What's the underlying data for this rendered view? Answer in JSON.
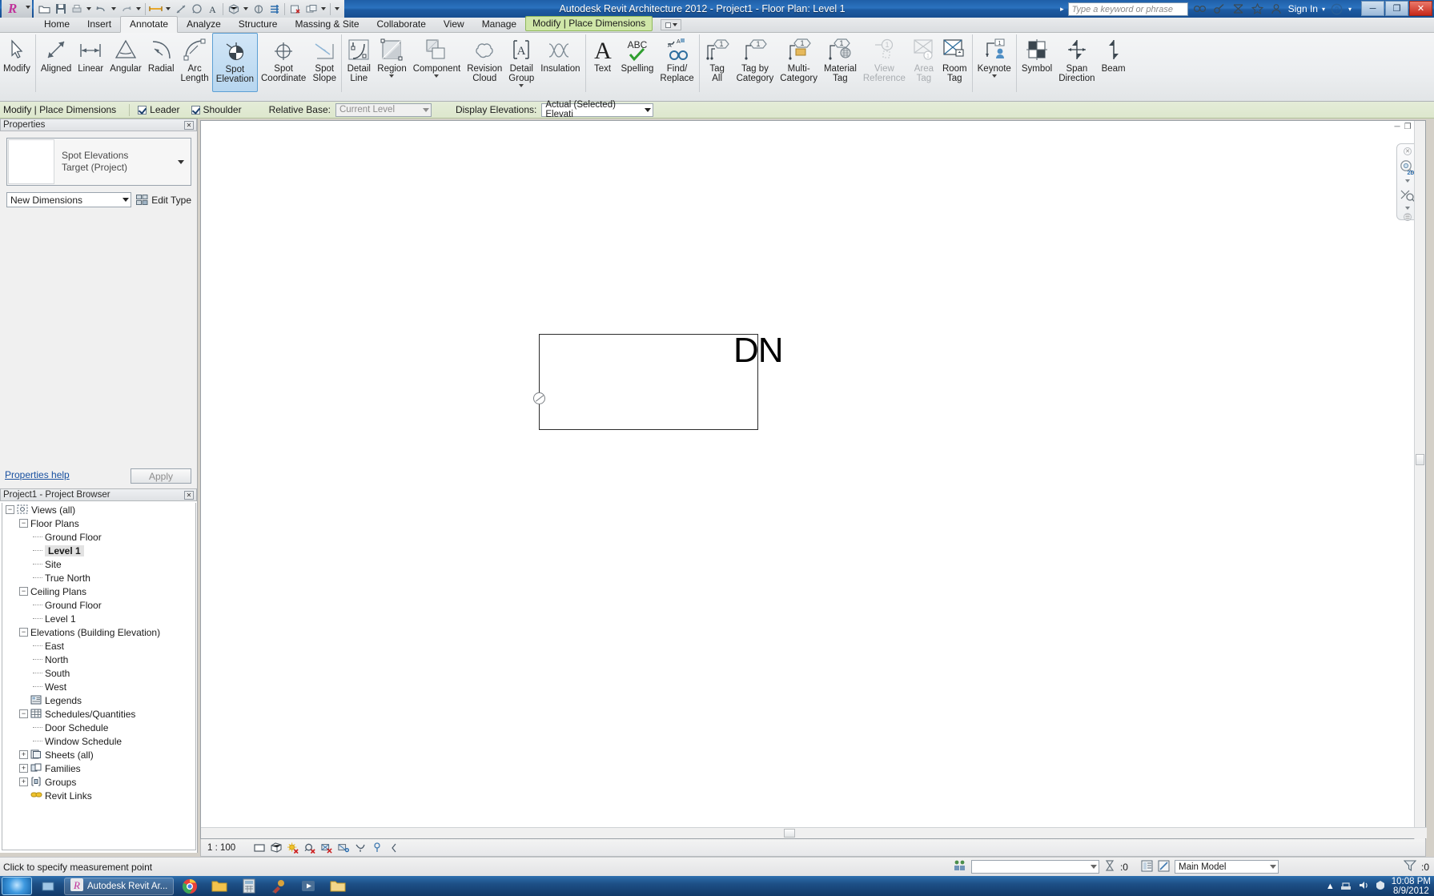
{
  "titlebar": {
    "app_title": "Autodesk Revit Architecture 2012 -    Project1 - Floor Plan: Level 1",
    "search_placeholder": "Type a keyword or phrase",
    "sign_in": "Sign In",
    "quick_access": [
      {
        "name": "open-icon",
        "label": "Open"
      },
      {
        "name": "save-icon",
        "label": "Save"
      },
      {
        "name": "print-icon",
        "label": "Print"
      },
      {
        "name": "undo-icon",
        "label": "Undo"
      },
      {
        "name": "redo-icon",
        "label": "Redo"
      },
      {
        "name": "measure-icon",
        "label": "Measure"
      },
      {
        "name": "aligned-dimension-icon",
        "label": "Aligned Dimension"
      },
      {
        "name": "tag-icon",
        "label": "Tag"
      },
      {
        "name": "text-icon",
        "label": "Text"
      },
      {
        "name": "default-3d-view-icon",
        "label": "Default 3D View"
      },
      {
        "name": "section-icon",
        "label": "Section"
      },
      {
        "name": "thin-lines-icon",
        "label": "Thin Lines"
      },
      {
        "name": "close-hidden-windows-icon",
        "label": "Close Hidden Windows"
      },
      {
        "name": "switch-windows-icon",
        "label": "Switch Windows"
      }
    ],
    "infocenter_icons": [
      {
        "name": "search-icon"
      },
      {
        "name": "subscription-icon"
      },
      {
        "name": "communication-center-icon"
      },
      {
        "name": "favorites-star-icon"
      },
      {
        "name": "user-account-icon"
      }
    ],
    "window_buttons": [
      {
        "name": "minimize-button",
        "glyph": "–"
      },
      {
        "name": "restore-button",
        "glyph": "❐"
      },
      {
        "name": "close-button",
        "glyph": "✕"
      }
    ]
  },
  "tabs": [
    {
      "label": "Home",
      "active": false
    },
    {
      "label": "Insert",
      "active": false
    },
    {
      "label": "Annotate",
      "active": true
    },
    {
      "label": "Analyze",
      "active": false
    },
    {
      "label": "Structure",
      "active": false
    },
    {
      "label": "Massing & Site",
      "active": false
    },
    {
      "label": "Collaborate",
      "active": false
    },
    {
      "label": "View",
      "active": false
    },
    {
      "label": "Manage",
      "active": false
    }
  ],
  "context_tab": "Modify | Place Dimensions",
  "ribbon": {
    "groups": [
      {
        "name": "select",
        "buttons": [
          {
            "label": "Modify",
            "icon": "cursor-arrow-icon",
            "state": "normal",
            "dropdown": false
          }
        ]
      },
      {
        "name": "dimension",
        "buttons": [
          {
            "label": "Aligned",
            "icon": "aligned-dimension-icon",
            "state": "normal",
            "dropdown": false
          },
          {
            "label": "Linear",
            "icon": "linear-dimension-icon",
            "state": "normal",
            "dropdown": false
          },
          {
            "label": "Angular",
            "icon": "angular-dimension-icon",
            "state": "normal",
            "dropdown": false
          },
          {
            "label": "Radial",
            "icon": "radial-dimension-icon",
            "state": "normal",
            "dropdown": false
          },
          {
            "label": "Arc\nLength",
            "icon": "arc-length-dimension-icon",
            "state": "normal",
            "dropdown": false
          },
          {
            "label": "Spot\nElevation",
            "icon": "spot-elevation-icon",
            "state": "selected",
            "dropdown": false
          },
          {
            "label": "Spot\nCoordinate",
            "icon": "spot-coordinate-icon",
            "state": "normal",
            "dropdown": false
          },
          {
            "label": "Spot\nSlope",
            "icon": "spot-slope-icon",
            "state": "normal",
            "dropdown": false
          }
        ]
      },
      {
        "name": "detail",
        "buttons": [
          {
            "label": "Detail\nLine",
            "icon": "detail-line-icon",
            "state": "normal",
            "dropdown": false
          },
          {
            "label": "Region",
            "icon": "region-icon",
            "state": "normal",
            "dropdown": true
          },
          {
            "label": "Component",
            "icon": "component-icon",
            "state": "normal",
            "dropdown": true
          },
          {
            "label": "Revision\nCloud",
            "icon": "revision-cloud-icon",
            "state": "normal",
            "dropdown": false
          },
          {
            "label": "Detail\nGroup",
            "icon": "detail-group-icon",
            "state": "normal",
            "dropdown": true
          },
          {
            "label": "Insulation",
            "icon": "insulation-icon",
            "state": "normal",
            "dropdown": false
          }
        ]
      },
      {
        "name": "text",
        "buttons": [
          {
            "label": "Text",
            "icon": "text-icon",
            "state": "normal",
            "dropdown": false
          },
          {
            "label": "Spelling",
            "icon": "spelling-check-icon",
            "state": "normal",
            "dropdown": false
          },
          {
            "label": "Find/\nReplace",
            "icon": "find-replace-icon",
            "state": "normal",
            "dropdown": false
          }
        ]
      },
      {
        "name": "tag",
        "buttons": [
          {
            "label": "Tag\nAll",
            "icon": "tag-all-icon",
            "state": "normal",
            "dropdown": false
          },
          {
            "label": "Tag by\nCategory",
            "icon": "tag-by-category-icon",
            "state": "normal",
            "dropdown": false
          },
          {
            "label": "Multi-\nCategory",
            "icon": "multi-category-tag-icon",
            "state": "normal",
            "dropdown": false
          },
          {
            "label": "Material\nTag",
            "icon": "material-tag-icon",
            "state": "normal",
            "dropdown": false
          },
          {
            "label": "View\nReference",
            "icon": "view-reference-icon",
            "state": "disabled",
            "dropdown": false
          },
          {
            "label": "Area\nTag",
            "icon": "area-tag-icon",
            "state": "disabled",
            "dropdown": false
          },
          {
            "label": "Room\nTag",
            "icon": "room-tag-icon",
            "state": "normal",
            "dropdown": false
          }
        ]
      },
      {
        "name": "keynote",
        "buttons": [
          {
            "label": "Keynote",
            "icon": "keynote-icon",
            "state": "normal",
            "dropdown": true
          }
        ]
      },
      {
        "name": "symbol",
        "buttons": [
          {
            "label": "Symbol",
            "icon": "symbol-icon",
            "state": "normal",
            "dropdown": false
          },
          {
            "label": "Span\nDirection",
            "icon": "span-direction-icon",
            "state": "normal",
            "dropdown": false
          },
          {
            "label": "Beam",
            "icon": "beam-annotation-icon",
            "state": "normal",
            "dropdown": false
          }
        ]
      }
    ]
  },
  "options_bar": {
    "context_label": "Modify | Place Dimensions",
    "leader_label": "Leader",
    "leader_checked": true,
    "shoulder_label": "Shoulder",
    "shoulder_checked": true,
    "relative_base_label": "Relative Base:",
    "relative_base_value": "Current Level",
    "display_elevations_label": "Display Elevations:",
    "display_elevations_value": "Actual (Selected) Elevati"
  },
  "properties": {
    "title": "Properties",
    "type_name_line1": "Spot Elevations",
    "type_name_line2": "Target (Project)",
    "instance_selector": "New Dimensions",
    "edit_type_label": "Edit Type",
    "help_link": "Properties help",
    "apply_label": "Apply"
  },
  "project_browser": {
    "title": "Project1 - Project Browser",
    "tree": [
      {
        "label": "Views (all)",
        "depth": 0,
        "expander": "minus",
        "icon": "views-icon",
        "selected": false
      },
      {
        "label": "Floor Plans",
        "depth": 1,
        "expander": "minus",
        "icon": "none",
        "selected": false
      },
      {
        "label": "Ground Floor",
        "depth": 2,
        "expander": "leaf",
        "icon": "none",
        "selected": false
      },
      {
        "label": "Level 1",
        "depth": 2,
        "expander": "leaf",
        "icon": "none",
        "selected": true
      },
      {
        "label": "Site",
        "depth": 2,
        "expander": "leaf",
        "icon": "none",
        "selected": false
      },
      {
        "label": "True North",
        "depth": 2,
        "expander": "leaf",
        "icon": "none",
        "selected": false
      },
      {
        "label": "Ceiling Plans",
        "depth": 1,
        "expander": "minus",
        "icon": "none",
        "selected": false
      },
      {
        "label": "Ground Floor",
        "depth": 2,
        "expander": "leaf",
        "icon": "none",
        "selected": false
      },
      {
        "label": "Level 1",
        "depth": 2,
        "expander": "leaf",
        "icon": "none",
        "selected": false
      },
      {
        "label": "Elevations (Building Elevation)",
        "depth": 1,
        "expander": "minus",
        "icon": "none",
        "selected": false
      },
      {
        "label": "East",
        "depth": 2,
        "expander": "leaf",
        "icon": "none",
        "selected": false
      },
      {
        "label": "North",
        "depth": 2,
        "expander": "leaf",
        "icon": "none",
        "selected": false
      },
      {
        "label": "South",
        "depth": 2,
        "expander": "leaf",
        "icon": "none",
        "selected": false
      },
      {
        "label": "West",
        "depth": 2,
        "expander": "leaf",
        "icon": "none",
        "selected": false
      },
      {
        "label": "Legends",
        "depth": 1,
        "expander": "none",
        "icon": "legends-icon",
        "selected": false
      },
      {
        "label": "Schedules/Quantities",
        "depth": 1,
        "expander": "minus",
        "icon": "schedules-icon",
        "selected": false
      },
      {
        "label": "Door Schedule",
        "depth": 2,
        "expander": "leaf",
        "icon": "none",
        "selected": false
      },
      {
        "label": "Window Schedule",
        "depth": 2,
        "expander": "leaf",
        "icon": "none",
        "selected": false
      },
      {
        "label": "Sheets (all)",
        "depth": 1,
        "expander": "plus",
        "icon": "sheets-icon",
        "selected": false
      },
      {
        "label": "Families",
        "depth": 1,
        "expander": "plus",
        "icon": "families-icon",
        "selected": false
      },
      {
        "label": "Groups",
        "depth": 1,
        "expander": "plus",
        "icon": "groups-icon",
        "selected": false
      },
      {
        "label": "Revit Links",
        "depth": 1,
        "expander": "none",
        "icon": "revit-links-icon",
        "selected": false
      }
    ]
  },
  "canvas": {
    "dn_label": "DN",
    "navigation_bar": {
      "wheel_label": "2D",
      "icons": [
        "steering-wheel-2d-icon",
        "zoom-tool-icon"
      ]
    }
  },
  "view_control_bar": {
    "scale": "1 : 100",
    "icons": [
      {
        "name": "detail-level-coarse-icon"
      },
      {
        "name": "visual-style-icon"
      },
      {
        "name": "sun-path-off-icon"
      },
      {
        "name": "shadows-off-icon"
      },
      {
        "name": "rendering-dialog-icon"
      },
      {
        "name": "crop-view-icon"
      },
      {
        "name": "show-crop-region-icon"
      },
      {
        "name": "temporary-hide-isolate-icon"
      },
      {
        "name": "reveal-hidden-elements-icon"
      }
    ]
  },
  "status_bar": {
    "message": "Click to specify measurement point",
    "worksets_value": "",
    "editable_only_count": ":0",
    "design_option": "Main Model",
    "filter_count": ":0"
  },
  "taskbar": {
    "items": [
      {
        "label": "Autodesk Revit Ar...",
        "icon": "revit-taskbar-icon",
        "active": true
      }
    ],
    "pinned": [
      {
        "name": "chrome-icon"
      },
      {
        "name": "explorer-icon"
      },
      {
        "name": "calculator-icon"
      },
      {
        "name": "paint-icon"
      },
      {
        "name": "media-icon"
      },
      {
        "name": "folder-icon"
      }
    ],
    "tray": [
      {
        "name": "network-icon"
      },
      {
        "name": "volume-icon"
      },
      {
        "name": "action-center-icon"
      }
    ],
    "time": "10:08 PM",
    "date": "8/9/2012"
  },
  "colors": {
    "title_blue": "#1d5ba3",
    "context_tab_green": "#cfe6a8",
    "selected_tool_blue": "#b7d6ef",
    "options_bar_green": "#dde7cd",
    "link_blue": "#1850a0"
  }
}
